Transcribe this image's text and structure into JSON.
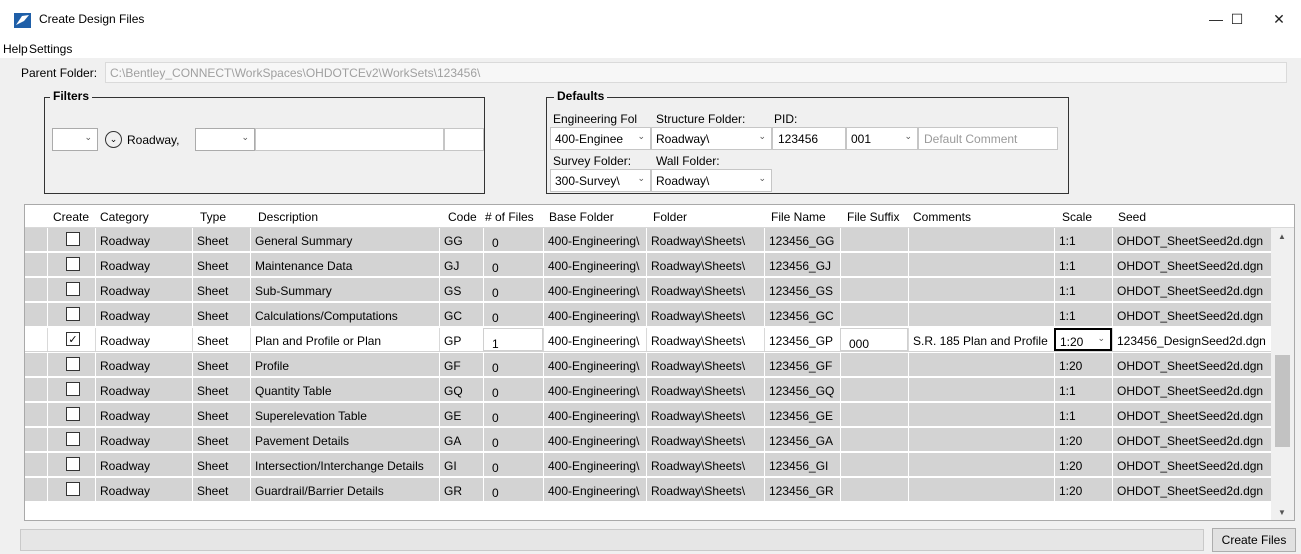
{
  "window": {
    "title": "Create Design Files",
    "minimize": "—",
    "maximize": "☐",
    "close": "✕"
  },
  "menu": {
    "help": "Help",
    "settings": "Settings"
  },
  "parent_folder": {
    "label": "Parent Folder:",
    "value": "C:\\Bentley_CONNECT\\WorkSpaces\\OHDOTCEv2\\WorkSets\\123456\\"
  },
  "filters": {
    "title": "Filters",
    "combo1": "",
    "category_filter": "Roadway,",
    "combo2": "",
    "text1": "",
    "text2": ""
  },
  "defaults": {
    "title": "Defaults",
    "engineering_label": "Engineering Fol",
    "engineering_value": "400-Enginee",
    "structure_label": "Structure Folder:",
    "structure_value": "Roadway\\",
    "pid_label": "PID:",
    "pid_value": "123456",
    "pid_suffix": "001",
    "comment_placeholder": "Default Comment",
    "survey_label": "Survey Folder:",
    "survey_value": "300-Survey\\",
    "wall_label": "Wall Folder:",
    "wall_value": "Roadway\\"
  },
  "grid": {
    "headers": [
      "Create",
      "Category",
      "Type",
      "Description",
      "Code",
      "# of Files",
      "Base Folder",
      "Folder",
      "File Name",
      "File Suffix",
      "Comments",
      "Scale",
      "Seed"
    ],
    "rows": [
      {
        "checked": false,
        "category": "Roadway",
        "type": "Sheet",
        "description": "General Summary",
        "code": "GG",
        "files": "0",
        "base": "400-Engineering\\",
        "folder": "Roadway\\Sheets\\",
        "filename": "123456_GG",
        "suffix": "",
        "comments": "",
        "scale": "1:1",
        "seed": "OHDOT_SheetSeed2d.dgn"
      },
      {
        "checked": false,
        "category": "Roadway",
        "type": "Sheet",
        "description": "Maintenance Data",
        "code": "GJ",
        "files": "0",
        "base": "400-Engineering\\",
        "folder": "Roadway\\Sheets\\",
        "filename": "123456_GJ",
        "suffix": "",
        "comments": "",
        "scale": "1:1",
        "seed": "OHDOT_SheetSeed2d.dgn"
      },
      {
        "checked": false,
        "category": "Roadway",
        "type": "Sheet",
        "description": "Sub-Summary",
        "code": "GS",
        "files": "0",
        "base": "400-Engineering\\",
        "folder": "Roadway\\Sheets\\",
        "filename": "123456_GS",
        "suffix": "",
        "comments": "",
        "scale": "1:1",
        "seed": "OHDOT_SheetSeed2d.dgn"
      },
      {
        "checked": false,
        "category": "Roadway",
        "type": "Sheet",
        "description": "Calculations/Computations",
        "code": "GC",
        "files": "0",
        "base": "400-Engineering\\",
        "folder": "Roadway\\Sheets\\",
        "filename": "123456_GC",
        "suffix": "",
        "comments": "",
        "scale": "1:1",
        "seed": "OHDOT_SheetSeed2d.dgn"
      },
      {
        "checked": true,
        "category": "Roadway",
        "type": "Sheet",
        "description": "Plan and Profile or Plan",
        "code": "GP",
        "files": "1",
        "base": "400-Engineering\\",
        "folder": "Roadway\\Sheets\\",
        "filename": "123456_GP",
        "suffix": "000",
        "comments": "S.R. 185 Plan and Profile",
        "scale": "1:20",
        "seed": "123456_DesignSeed2d.dgn"
      },
      {
        "checked": false,
        "category": "Roadway",
        "type": "Sheet",
        "description": "Profile",
        "code": "GF",
        "files": "0",
        "base": "400-Engineering\\",
        "folder": "Roadway\\Sheets\\",
        "filename": "123456_GF",
        "suffix": "",
        "comments": "",
        "scale": "1:20",
        "seed": "OHDOT_SheetSeed2d.dgn"
      },
      {
        "checked": false,
        "category": "Roadway",
        "type": "Sheet",
        "description": "Quantity Table",
        "code": "GQ",
        "files": "0",
        "base": "400-Engineering\\",
        "folder": "Roadway\\Sheets\\",
        "filename": "123456_GQ",
        "suffix": "",
        "comments": "",
        "scale": "1:1",
        "seed": "OHDOT_SheetSeed2d.dgn"
      },
      {
        "checked": false,
        "category": "Roadway",
        "type": "Sheet",
        "description": "Superelevation Table",
        "code": "GE",
        "files": "0",
        "base": "400-Engineering\\",
        "folder": "Roadway\\Sheets\\",
        "filename": "123456_GE",
        "suffix": "",
        "comments": "",
        "scale": "1:1",
        "seed": "OHDOT_SheetSeed2d.dgn"
      },
      {
        "checked": false,
        "category": "Roadway",
        "type": "Sheet",
        "description": "Pavement Details",
        "code": "GA",
        "files": "0",
        "base": "400-Engineering\\",
        "folder": "Roadway\\Sheets\\",
        "filename": "123456_GA",
        "suffix": "",
        "comments": "",
        "scale": "1:20",
        "seed": "OHDOT_SheetSeed2d.dgn"
      },
      {
        "checked": false,
        "category": "Roadway",
        "type": "Sheet",
        "description": "Intersection/Interchange Details",
        "code": "GI",
        "files": "0",
        "base": "400-Engineering\\",
        "folder": "Roadway\\Sheets\\",
        "filename": "123456_GI",
        "suffix": "",
        "comments": "",
        "scale": "1:20",
        "seed": "OHDOT_SheetSeed2d.dgn"
      },
      {
        "checked": false,
        "category": "Roadway",
        "type": "Sheet",
        "description": "Guardrail/Barrier Details",
        "code": "GR",
        "files": "0",
        "base": "400-Engineering\\",
        "folder": "Roadway\\Sheets\\",
        "filename": "123456_GR",
        "suffix": "",
        "comments": "",
        "scale": "1:20",
        "seed": "OHDOT_SheetSeed2d.dgn"
      }
    ]
  },
  "status_text": "",
  "create_button": "Create Files",
  "icons": {
    "app": "create-design-files-icon",
    "chevron": "chevron-down-icon",
    "circle": "expand-circle-icon",
    "check": "check-icon"
  },
  "colors": {
    "row_bg": "#d3d3d3",
    "selected_row_bg": "#ffffff",
    "window_bg": "#f0f0f0"
  }
}
